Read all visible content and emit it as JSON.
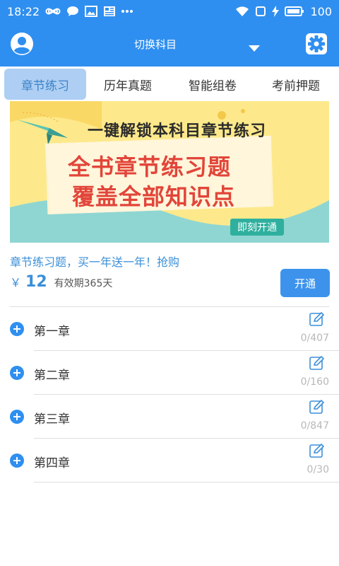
{
  "status_bar": {
    "time": "18:22",
    "battery": "100",
    "icons_left": [
      "infinity-icon",
      "chat-bubble-icon",
      "image-icon",
      "news-icon",
      "more-dots-icon"
    ],
    "icons_right": [
      "wifi-icon",
      "sim-icon",
      "charging-icon",
      "battery-icon"
    ]
  },
  "header": {
    "title": "切换科目",
    "left_icon": "user-avatar-icon",
    "right_icon": "gear-icon",
    "dropdown_icon": "caret-down-icon",
    "bg_color": "#2f8ff0"
  },
  "tabs": [
    {
      "label": "章节练习",
      "active": true
    },
    {
      "label": "历年真题",
      "active": false
    },
    {
      "label": "智能组卷",
      "active": false
    },
    {
      "label": "考前押题",
      "active": false
    }
  ],
  "banner": {
    "line1": "一键解锁本科目章节练习",
    "line2": "全书章节练习题",
    "line3": "覆盖全部知识点",
    "button": "即刻开通"
  },
  "promo": {
    "text": "章节练习题，买一年送一年！抢购",
    "currency": "￥",
    "price": "12",
    "validity": "有效期365天",
    "button": "开通"
  },
  "chapters": [
    {
      "name": "第一章",
      "count": "0/407"
    },
    {
      "name": "第二章",
      "count": "0/160"
    },
    {
      "name": "第三章",
      "count": "0/847"
    },
    {
      "name": "第四章",
      "count": "0/30"
    }
  ],
  "colors": {
    "accent": "#2f8ff0",
    "tab_active_bg": "#aecff3",
    "promo_text": "#3b8fd8",
    "count_text": "#b8b8b8"
  }
}
